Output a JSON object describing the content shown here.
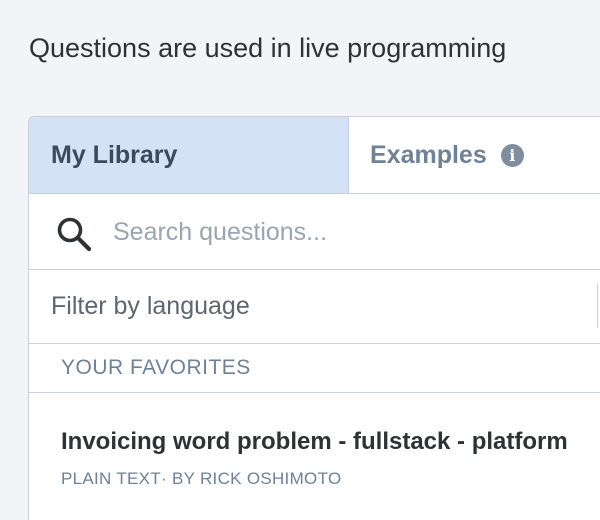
{
  "intro_text": "Questions are used in live programming",
  "tabs": [
    {
      "label": "My Library",
      "active": true
    },
    {
      "label": "Examples",
      "active": false,
      "icon": "info-icon"
    }
  ],
  "search": {
    "placeholder": "Search questions...",
    "value": "",
    "icon": "search-icon"
  },
  "filter": {
    "label": "Filter by language"
  },
  "favorites": {
    "header": "YOUR FAVORITES",
    "items": [
      {
        "title": "Invoicing word problem - fullstack - platform",
        "language": "PLAIN TEXT",
        "byline": "· BY RICK OSHIMOTO"
      }
    ]
  },
  "colors": {
    "page_background": "#f3f4f8",
    "active_tab_background": "#d4e2f6",
    "border": "#c9d0db",
    "muted_text": "#6e8196",
    "primary_text": "#2f3235"
  }
}
